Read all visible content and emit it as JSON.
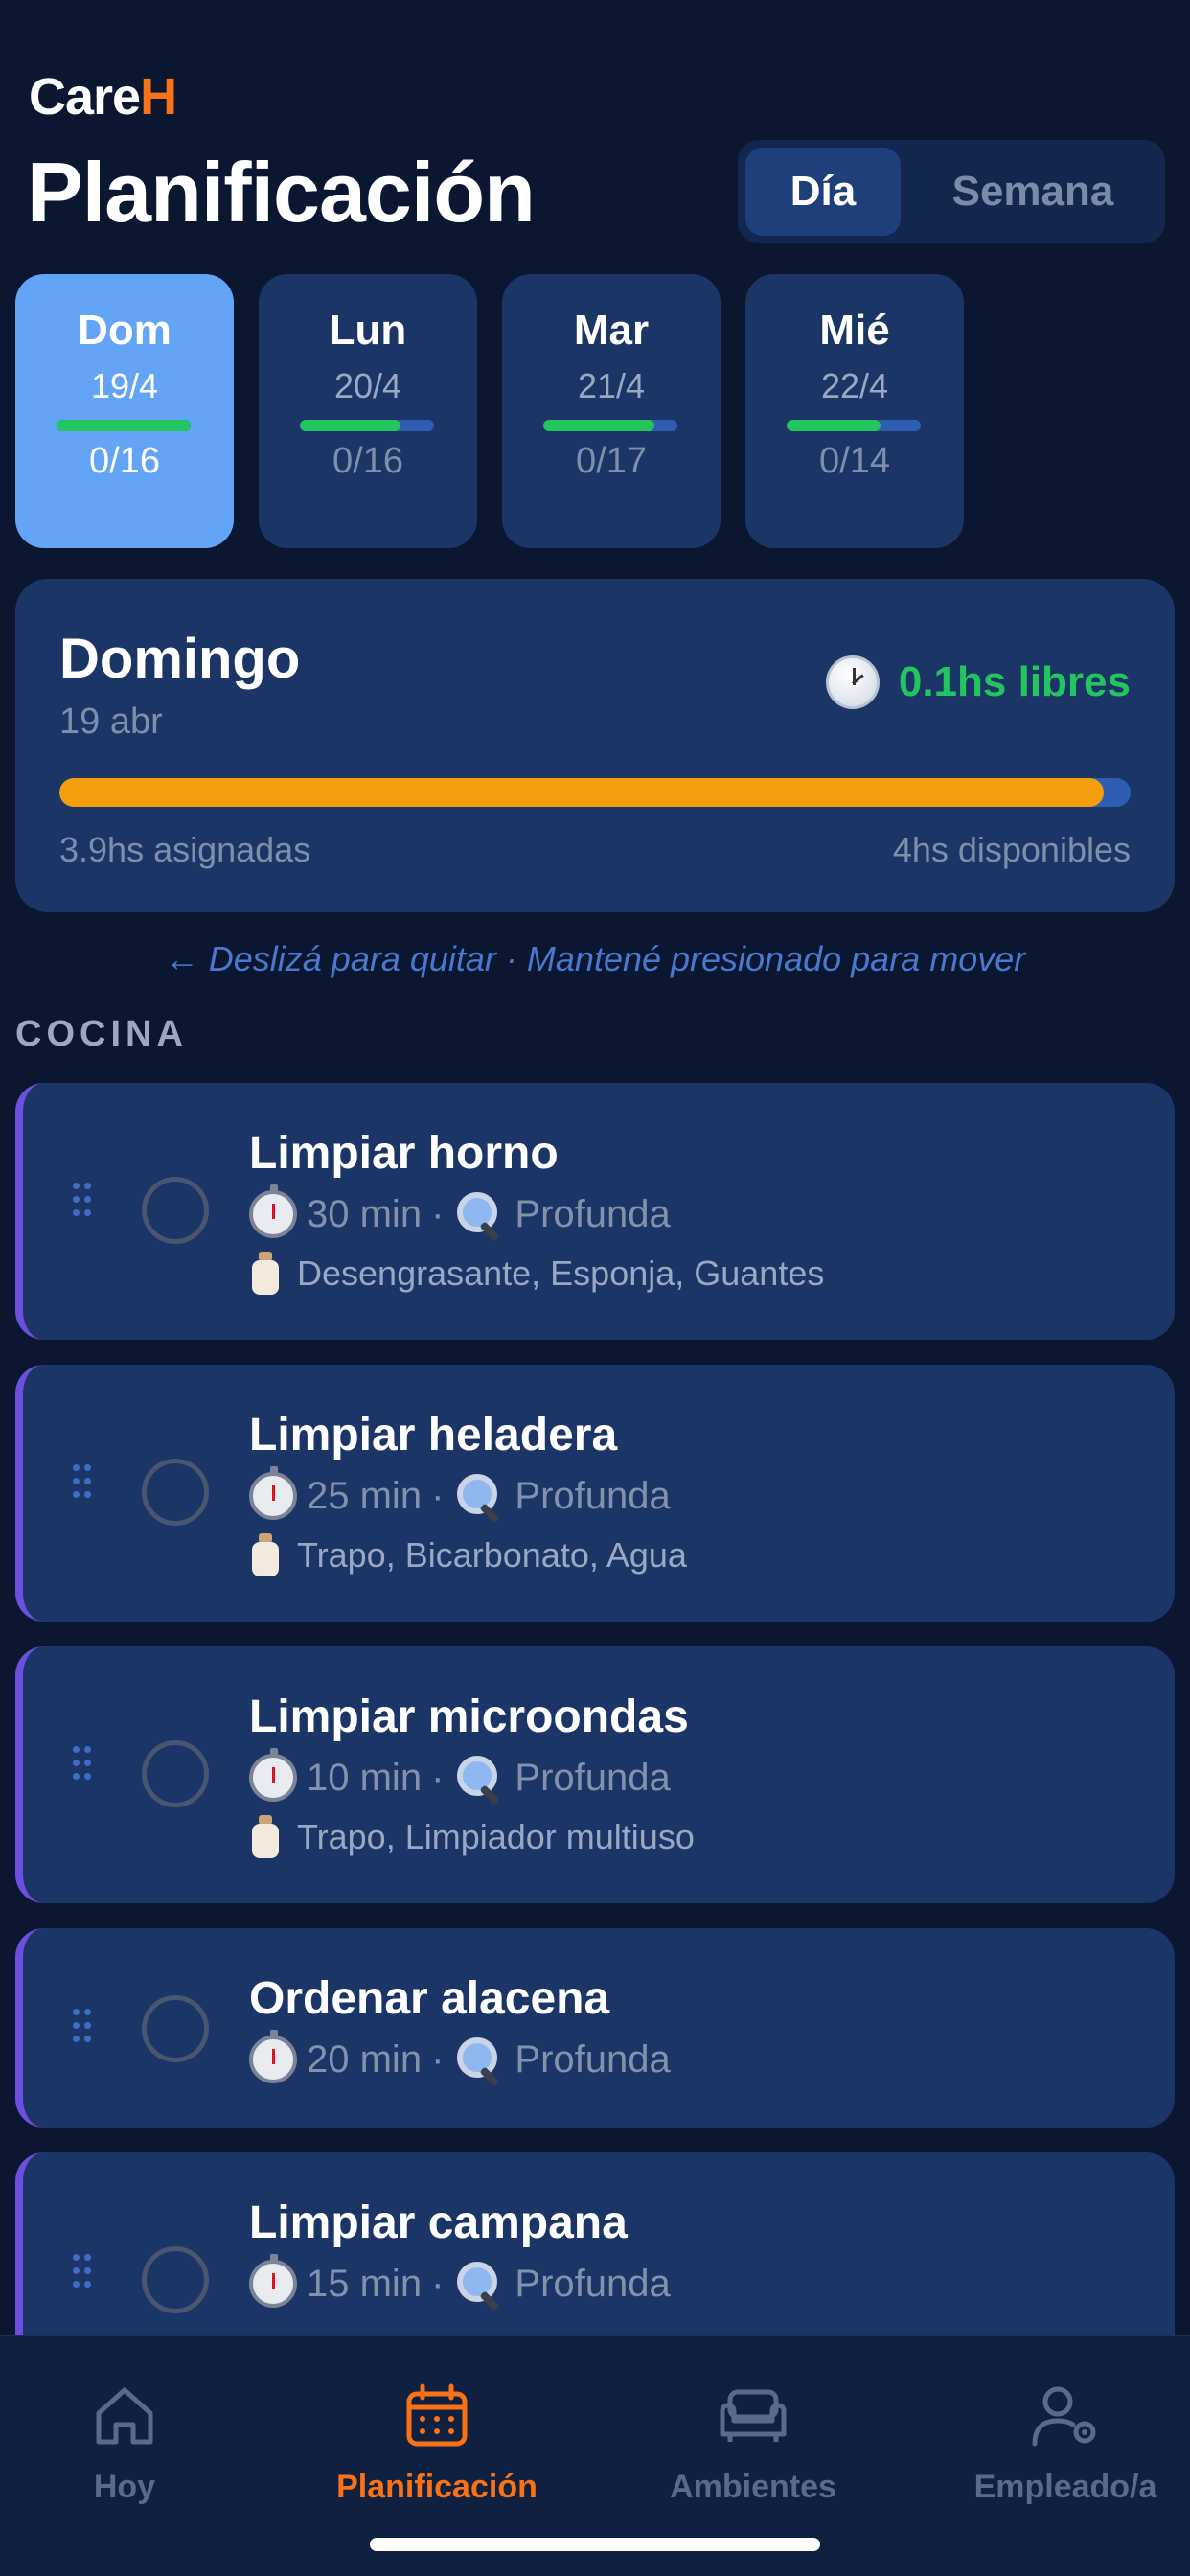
{
  "brand": {
    "prefix": "Care",
    "accent": "H"
  },
  "header": {
    "title": "Planificación"
  },
  "view_toggle": {
    "day_label": "Día",
    "week_label": "Semana",
    "selected": "Día"
  },
  "days": [
    {
      "name": "Dom",
      "date": "19/4",
      "count": "0/16",
      "progress": 1.0,
      "selected": true
    },
    {
      "name": "Lun",
      "date": "20/4",
      "count": "0/16",
      "progress": 0.75,
      "selected": false
    },
    {
      "name": "Mar",
      "date": "21/4",
      "count": "0/17",
      "progress": 0.83,
      "selected": false
    },
    {
      "name": "Mié",
      "date": "22/4",
      "count": "0/14",
      "progress": 0.7,
      "selected": false
    }
  ],
  "summary": {
    "day_name": "Domingo",
    "date": "19 abr",
    "free_label": "0.1hs libres",
    "assigned_label": "3.9hs asignadas",
    "available_label": "4hs disponibles",
    "progress": 0.975
  },
  "hint": "← Deslizá para quitar · Mantené presionado para mover",
  "section_title": "COCINA",
  "tasks": [
    {
      "name": "Limpiar horno",
      "duration": "30 min",
      "type": "Profunda",
      "tools": "Desengrasante, Esponja, Guantes"
    },
    {
      "name": "Limpiar heladera",
      "duration": "25 min",
      "type": "Profunda",
      "tools": "Trapo, Bicarbonato, Agua"
    },
    {
      "name": "Limpiar microondas",
      "duration": "10 min",
      "type": "Profunda",
      "tools": "Trapo, Limpiador multiuso"
    },
    {
      "name": "Ordenar alacena",
      "duration": "20 min",
      "type": "Profunda",
      "tools": ""
    },
    {
      "name": "Limpiar campana",
      "duration": "15 min",
      "type": "Profunda",
      "tools": ""
    }
  ],
  "meta_separator": "·",
  "nav": [
    {
      "label": "Hoy",
      "icon": "home-icon",
      "active": false
    },
    {
      "label": "Planificación",
      "icon": "calendar-icon",
      "active": true
    },
    {
      "label": "Ambientes",
      "icon": "sofa-icon",
      "active": false
    },
    {
      "label": "Empleado/a",
      "icon": "user-gear-icon",
      "active": false
    }
  ],
  "colors": {
    "background": "#0b1630",
    "card": "#1b3566",
    "accent_orange": "#f97316",
    "progress_orange": "#f59e0b",
    "green": "#22c55e",
    "selected_day": "#64a4f6",
    "task_border": "#6d4fe0"
  }
}
